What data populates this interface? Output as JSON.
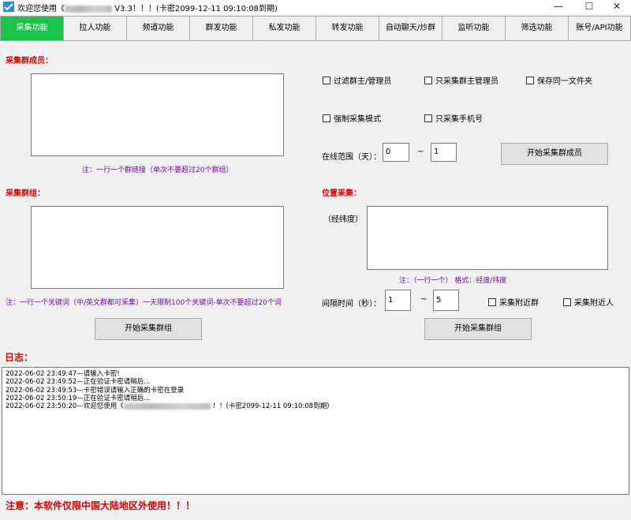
{
  "titlebar": {
    "title_prefix": "欢迎您使用《",
    "title_suffix": "V3.3！！！(卡密2099-12-11 09:10:08到期)",
    "minimize": "—",
    "maximize": "☐",
    "close": "✕"
  },
  "tabs": [
    {
      "label": "采集功能",
      "active": true
    },
    {
      "label": "拉人功能",
      "active": false
    },
    {
      "label": "频道功能",
      "active": false
    },
    {
      "label": "群发功能",
      "active": false
    },
    {
      "label": "私发功能",
      "active": false
    },
    {
      "label": "转发功能",
      "active": false
    },
    {
      "label": "自动聊天/炒群",
      "active": false
    },
    {
      "label": "监听功能",
      "active": false
    },
    {
      "label": "筛选功能",
      "active": false
    },
    {
      "label": "账号/API功能",
      "active": false
    }
  ],
  "members": {
    "title": "采集群成员：",
    "note": "注：一行一个群链接（单次不要超过20个群组）",
    "options": {
      "filter_admin": "过滤群主/管理员",
      "only_admin": "只采集群主管理员",
      "same_folder": "保存同一文件夹",
      "force_mode": "强制采集模式",
      "only_phone": "只采集手机号"
    },
    "online_label": "在线范围（天）：",
    "online_from": "0",
    "tilde": "~",
    "online_to": "1",
    "start_button": "开始采集群成员"
  },
  "groups": {
    "title": "采集群组：",
    "note": "注：一行一个关键词（中/英文群都可采集）一天限制100个关键词-单次不要超过20个词",
    "start_button": "开始采集群组"
  },
  "location": {
    "title": "位置采集：",
    "coord_label": "（经纬度）",
    "note": "注：（一行一个） 格式：经度/纬度",
    "interval_label": "间隔时间（秒）：",
    "interval_from": "1",
    "tilde": "~",
    "interval_to": "5",
    "nearby_groups": "采集附近群",
    "nearby_people": "采集附近人",
    "start_button": "开始采集群组"
  },
  "log": {
    "title": "日志：",
    "lines": [
      "2022-06-02 23:49:47—请输入卡密!",
      "2022-06-02 23:49:52—正在验证卡密请稍后...",
      "2022-06-02 23:49:53—卡密错误请输入正确的卡密在登录",
      "2022-06-02 23:50:19—正在验证卡密请稍后...",
      "2022-06-02 23:50:20—欢迎您使用《"
    ],
    "last_line_suffix": "！！(卡密2099-12-11 09:10:08到期)"
  },
  "footer": {
    "warning": "注意：本软件仅限中国大陆地区外使用！！！"
  },
  "colors": {
    "active_tab": "#1bc34a",
    "label_red": "#e00000",
    "note_purple": "#7010b0"
  }
}
